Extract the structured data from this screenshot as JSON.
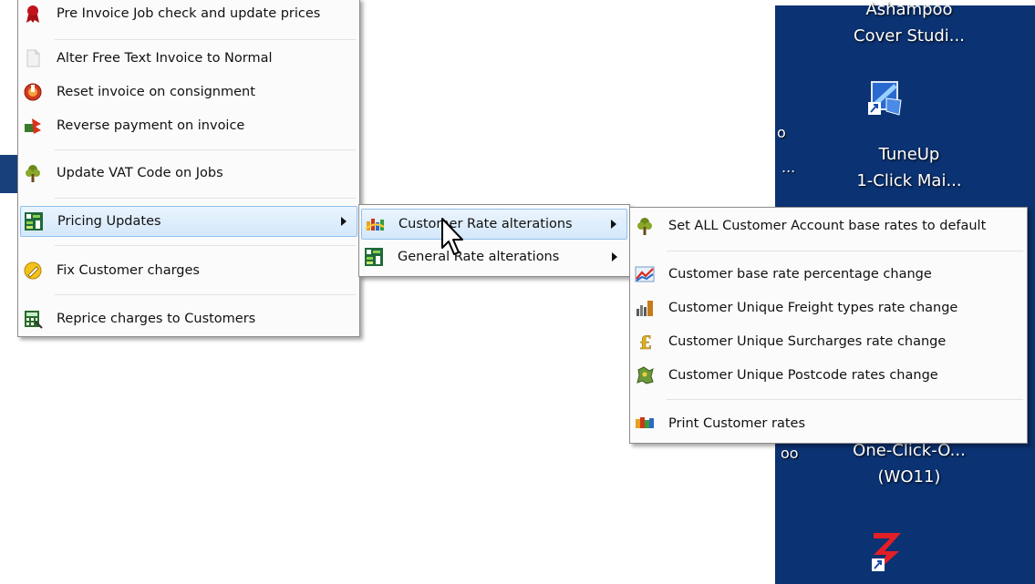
{
  "desktop": {
    "items": [
      {
        "line1": "Ashampoo",
        "line2": "Cover Studi..."
      },
      {
        "line1": "TuneUp",
        "line2": "1-Click Mai..."
      },
      {
        "line1": "One-Click-O...",
        "line2": "(WO11)"
      }
    ],
    "partials": [
      "o",
      "...",
      "oo"
    ]
  },
  "main_menu": {
    "items": [
      {
        "label": "Pre Invoice Job check and update prices",
        "icon": "ribbon-icon"
      },
      {
        "label": "Alter Free Text Invoice to Normal",
        "icon": "document-icon"
      },
      {
        "label": "Reset invoice on consignment",
        "icon": "reset-icon"
      },
      {
        "label": "Reverse payment on invoice",
        "icon": "reverse-payment-icon"
      },
      {
        "label": "Update VAT Code on Jobs",
        "icon": "tree-icon"
      },
      {
        "label": "Pricing Updates",
        "icon": "pricing-icon",
        "submenu": true,
        "highlighted": true
      },
      {
        "label": "Fix Customer charges",
        "icon": "pencil-icon"
      },
      {
        "label": "Reprice charges to Customers",
        "icon": "calculator-icon"
      }
    ]
  },
  "pricing_submenu": {
    "items": [
      {
        "label": "Customer Rate alterations",
        "icon": "rate-chart-icon",
        "submenu": true,
        "highlighted": true
      },
      {
        "label": "General Rate alterations",
        "icon": "pricing-icon",
        "submenu": true
      }
    ]
  },
  "customer_rate_submenu": {
    "items": [
      {
        "label": "Set ALL Customer Account base rates to default",
        "icon": "tree-icon"
      },
      {
        "label": "Customer base rate percentage change",
        "icon": "line-chart-icon"
      },
      {
        "label": "Customer Unique Freight types rate change",
        "icon": "bar-chart-icon"
      },
      {
        "label": "Customer Unique Surcharges rate change",
        "icon": "pound-icon"
      },
      {
        "label": "Customer Unique Postcode rates change",
        "icon": "map-icon"
      },
      {
        "label": "Print Customer rates",
        "icon": "print-rates-icon"
      }
    ]
  },
  "colors": {
    "highlight_border": "#90c0ee",
    "desktop_background": "#0b3272",
    "menu_background": "#fbfbfb"
  }
}
